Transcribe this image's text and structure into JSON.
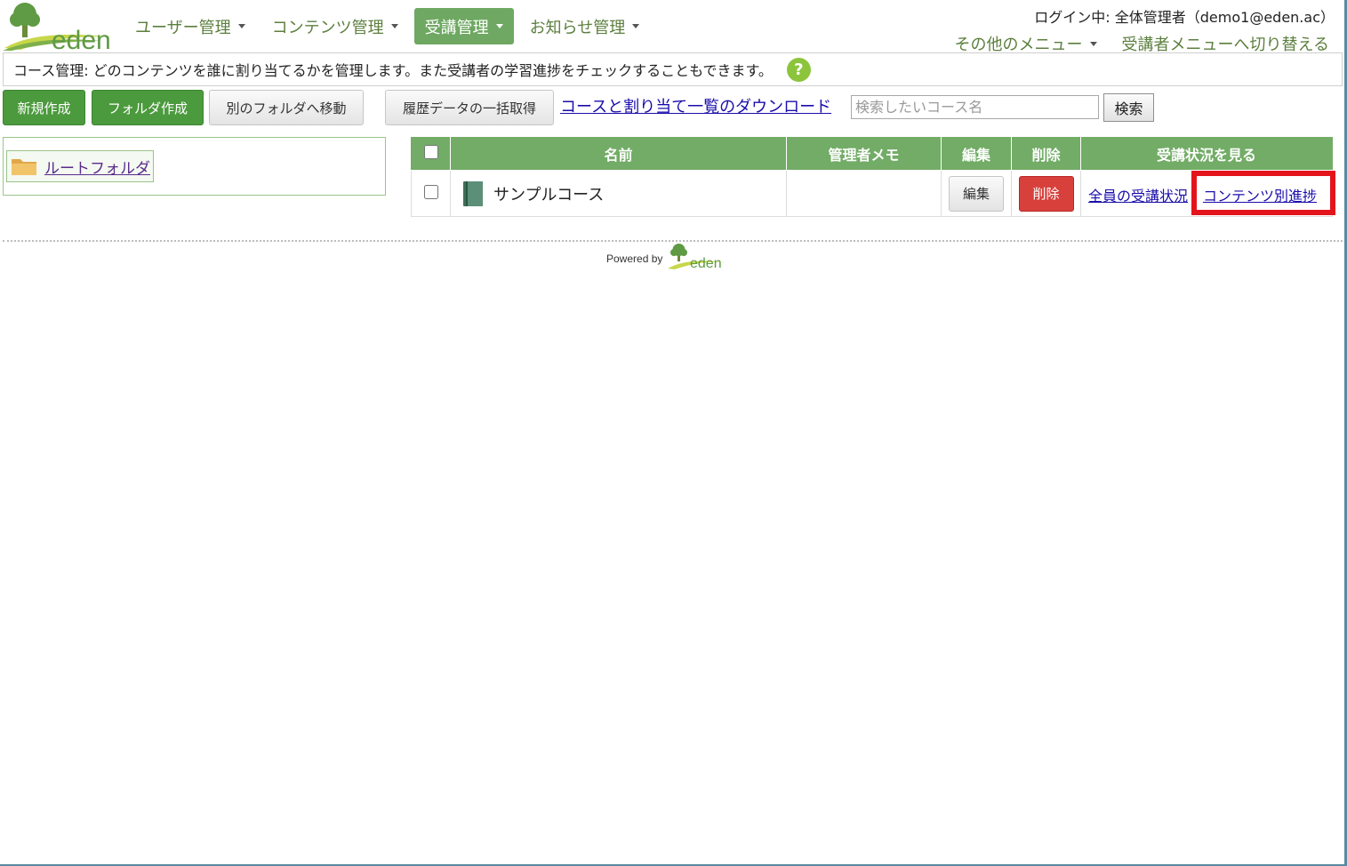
{
  "brand": {
    "logo_text": "eden",
    "primary_green": "#6ea862",
    "link_color": "#1a0dab"
  },
  "nav": {
    "items": [
      {
        "label": "ユーザー管理",
        "active": false
      },
      {
        "label": "コンテンツ管理",
        "active": false
      },
      {
        "label": "受講管理",
        "active": true
      },
      {
        "label": "お知らせ管理",
        "active": false
      }
    ]
  },
  "header": {
    "login_info": "ログイン中: 全体管理者（demo1@eden.ac）",
    "other_menu": "その他のメニュー",
    "switch_menu": "受講者メニューへ切り替える"
  },
  "description": {
    "text": "コース管理: どのコンテンツを誰に割り当てるかを管理します。また受講者の学習進捗をチェックすることもできます。",
    "help_icon": "question-icon"
  },
  "toolbar": {
    "new_label": "新規作成",
    "new_folder_label": "フォルダ作成",
    "move_label": "別のフォルダへ移動",
    "history_label": "履歴データの一括取得",
    "download_link": "コースと割り当て一覧のダウンロード",
    "search_placeholder": "検索したいコース名",
    "search_label": "検索"
  },
  "folders": {
    "root_label": "ルートフォルダ"
  },
  "table": {
    "headers": {
      "name": "名前",
      "memo": "管理者メモ",
      "edit": "編集",
      "delete": "削除",
      "status": "受講状況を見る"
    },
    "rows": [
      {
        "name": "サンプルコース",
        "memo": "",
        "edit_label": "編集",
        "delete_label": "削除",
        "status_all": "全員の受講状況",
        "status_by_content": "コンテンツ別進捗"
      }
    ]
  },
  "footer": {
    "powered_by": "Powered by",
    "logo_text": "eden"
  }
}
